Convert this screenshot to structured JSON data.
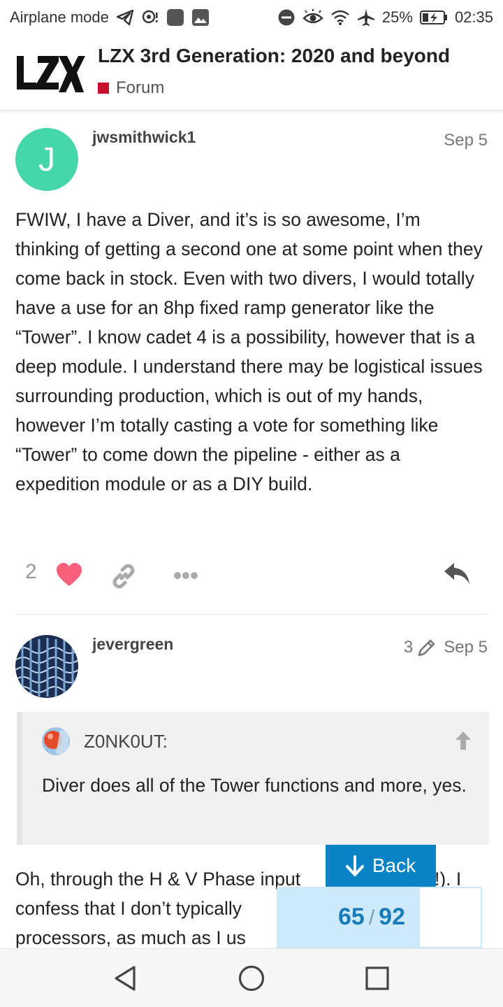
{
  "status_bar": {
    "left_text": "Airplane mode",
    "battery": "25%",
    "time": "02:35"
  },
  "header": {
    "logo_text": "LZX",
    "title": "LZX 3rd Generation: 2020 and beyond",
    "category": "Forum",
    "category_color": "#c8102e"
  },
  "posts": [
    {
      "avatar_letter": "J",
      "avatar_color": "#45d6a9",
      "username": "jwsmithwick1",
      "date": "Sep 5",
      "body": "FWIW, I have a Diver, and it’s is so awesome, I’m thinking of getting a second one at some point when they come back in stock. Even with two divers, I would totally have a use for an 8hp fixed ramp generator like the “Tower”. I know cadet 4 is a possibility, however that is a deep module. I understand there may be logistical issues surrounding production, which is out of my hands, however I’m totally casting a vote for something like “Tower” to come down the pipeline - either as a expedition module or as a DIY build.",
      "like_count": "2"
    },
    {
      "username": "jevergreen",
      "edit_count": "3",
      "date": "Sep 5",
      "quote": {
        "author": "Z0NK0UT:",
        "text": "Diver does all of the Tower functions and more, yes."
      },
      "body_line1_start": "Oh, through the H & V Phase input",
      "body_line1_end": "!). I",
      "body_line2_start": "confess that I don’t typically",
      "body_line3_start": "processors, as much as I us"
    }
  ],
  "back_button": {
    "label": "Back"
  },
  "progress": {
    "current": "65",
    "total": "92",
    "fraction": 0.7
  }
}
